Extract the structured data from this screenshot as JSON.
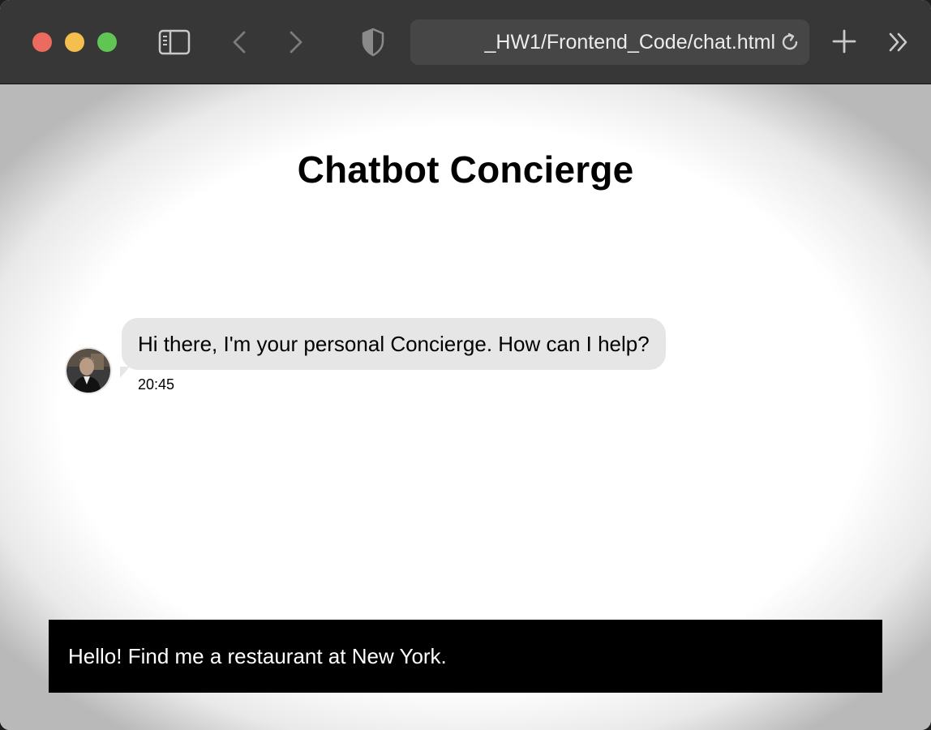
{
  "browser": {
    "url_display": "_HW1/Frontend_Code/chat.html",
    "icons": {
      "sidebar": "sidebar-icon",
      "back": "chevron-left-icon",
      "forward": "chevron-right-icon",
      "privacy": "shield-icon",
      "reload": "reload-icon",
      "new_tab": "plus-icon",
      "more": "double-chevron-right-icon"
    },
    "traffic_colors": {
      "close": "#ed6a5e",
      "minimize": "#f5bf4f",
      "maximize": "#61c554"
    }
  },
  "page": {
    "title": "Chatbot Concierge"
  },
  "chat": {
    "messages": [
      {
        "sender": "bot",
        "text": "Hi there, I'm your personal Concierge. How can I help?",
        "time": "20:45"
      }
    ]
  },
  "composer": {
    "value": "Hello! Find me a restaurant at New York."
  }
}
